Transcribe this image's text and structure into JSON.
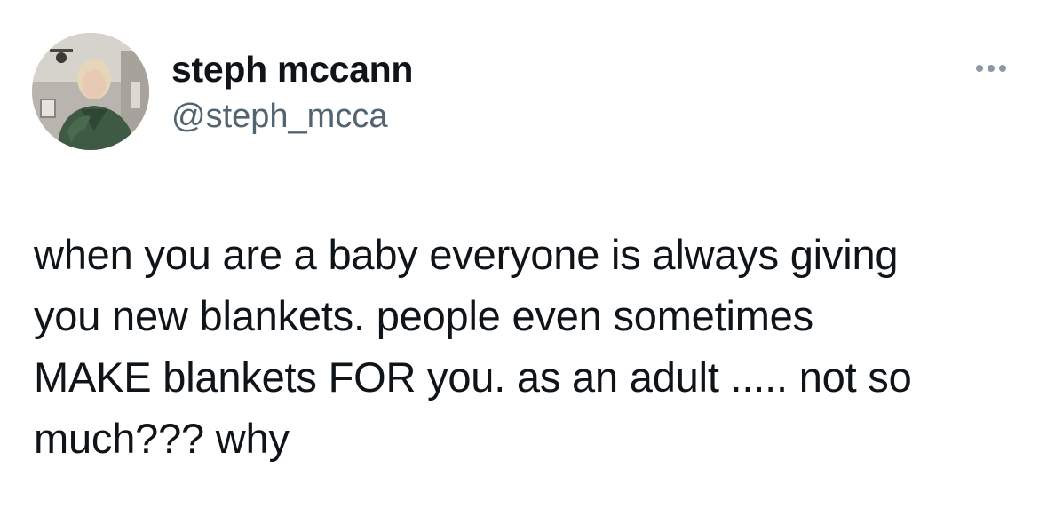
{
  "author": {
    "display_name": "steph mccann",
    "handle": "@steph_mcca",
    "avatar_icon": "profile-photo"
  },
  "more_menu": {
    "icon": "more-horizontal-icon"
  },
  "tweet": {
    "lines": [
      "when you are a baby everyone is always giving",
      "you new blankets. people even sometimes",
      "MAKE blankets FOR you. as an adult ..... not so",
      "much??? why"
    ]
  },
  "colors": {
    "text_primary": "#0f1419",
    "text_secondary": "#536471",
    "icon_muted": "#8b98a5",
    "background": "#ffffff"
  }
}
